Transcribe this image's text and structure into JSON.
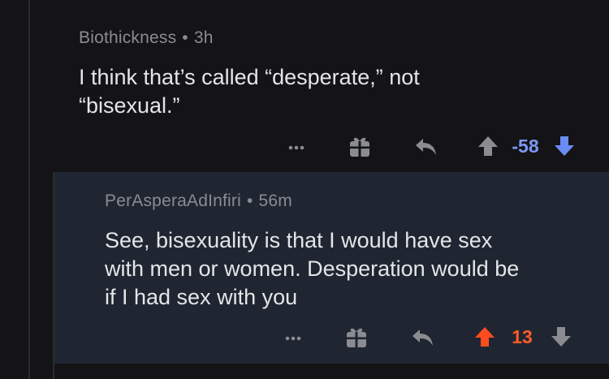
{
  "comments": [
    {
      "author": "Biothickness",
      "separator": "•",
      "age": "3h",
      "body_lines": [
        "I think that’s called “desperate,” not",
        "“bisexual.”"
      ],
      "score": "-58",
      "vote_state": "downvoted",
      "colors": {
        "score": "#7d97f4",
        "upvote": "#8a8c91",
        "downvote": "#6a8cf5"
      }
    },
    {
      "author": "PerAsperaAdInfiri",
      "separator": "•",
      "age": "56m",
      "body_lines": [
        "See, bisexuality is that I would have sex",
        "with men or women. Desperation would be",
        "if I had sex with you"
      ],
      "score": "13",
      "vote_state": "upvoted",
      "colors": {
        "score": "#ff5a2b",
        "upvote": "#ff4c1f",
        "downvote": "#8a8c91"
      }
    }
  ],
  "icons": {
    "more": "more-horizontal-icon",
    "award": "gift-icon",
    "reply": "reply-arrow-icon",
    "upvote": "upvote-arrow-icon",
    "downvote": "downvote-arrow-icon"
  }
}
